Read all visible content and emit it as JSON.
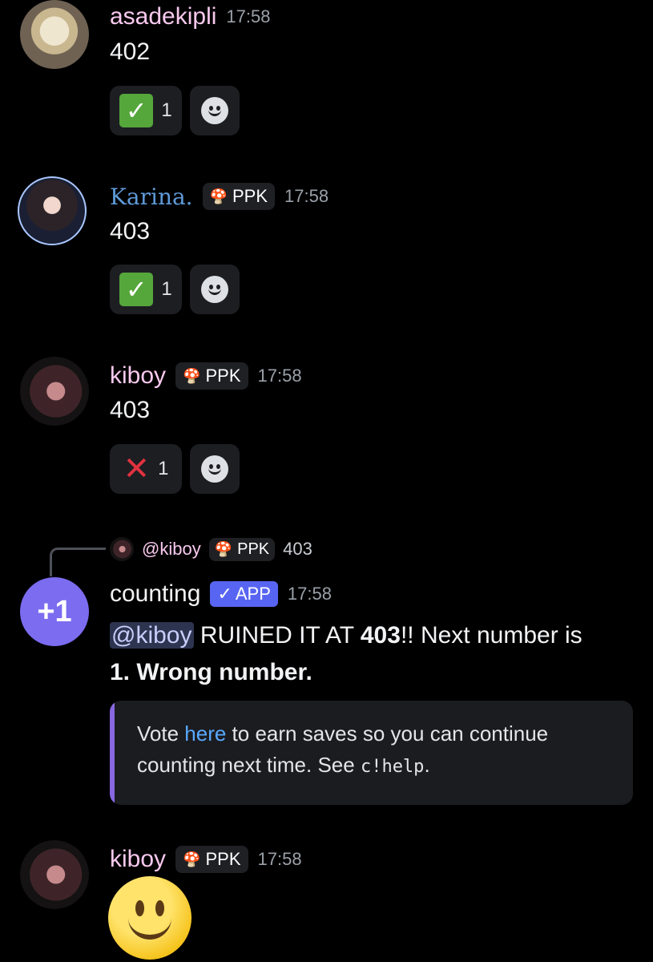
{
  "messages": [
    {
      "username": "asadekipli",
      "time": "17:58",
      "text": "402",
      "reaction": {
        "emoji": "check",
        "count": "1"
      }
    },
    {
      "username": "Karina.",
      "tag": "PPK",
      "time": "17:58",
      "text": "403",
      "reaction": {
        "emoji": "check",
        "count": "1"
      }
    },
    {
      "username": "kiboy",
      "tag": "PPK",
      "time": "17:58",
      "text": "403",
      "reaction": {
        "emoji": "cross",
        "count": "1"
      }
    },
    {
      "reply": {
        "mention": "@kiboy",
        "tag": "PPK",
        "text": "403"
      },
      "username": "counting",
      "app_badge": "APP",
      "app_check": "✓",
      "time": "17:58",
      "avatar_text": "+1",
      "mention": "@kiboy",
      "text_part1": " RUINED IT AT ",
      "text_bold": "403",
      "text_part2": "!! Next number is",
      "text_line2": "1. Wrong number.",
      "embed": {
        "prefix": "Vote ",
        "link": "here",
        "middle": " to earn saves so you can continue",
        "line2": "counting next time. See ",
        "code": "c!help",
        "suffix": "."
      }
    },
    {
      "username": "kiboy",
      "tag": "PPK",
      "time": "17:58",
      "emoji": "slightly-smiling-face"
    }
  ],
  "colors": {
    "background": "#000000",
    "username_pink": "#f9c9ee",
    "username_karina": "#5e9ad8",
    "app_badge": "#5865f2",
    "bot_avatar": "#7c6cf0",
    "embed_bar": "#8867e0",
    "link": "#5aa8ff"
  }
}
